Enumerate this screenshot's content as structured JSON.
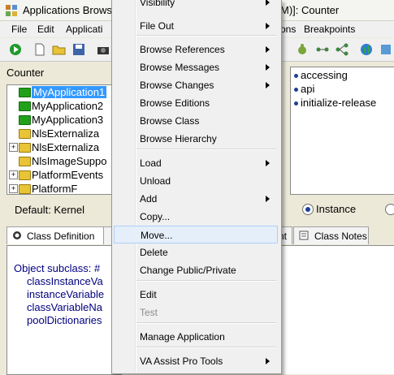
{
  "window": {
    "title_left": "Applications Browse",
    "title_right": "M)]: Counter"
  },
  "menubar": {
    "file": "File",
    "edit": "Edit",
    "applications": "Applicati",
    "options": "ons",
    "breakpoints": "Breakpoints"
  },
  "left": {
    "header": "Counter",
    "tree": [
      {
        "label": "MyApplication1",
        "expander": "",
        "selected": true
      },
      {
        "label": "MyApplication2",
        "expander": "",
        "selected": false
      },
      {
        "label": "MyApplication3",
        "expander": "",
        "selected": false
      },
      {
        "label": "NlsExternaliza",
        "expander": "",
        "selected": false
      },
      {
        "label": "NlsExternaliza",
        "expander": "+",
        "selected": false
      },
      {
        "label": "NlsImageSuppo",
        "expander": "",
        "selected": false
      },
      {
        "label": "PlatformEvents",
        "expander": "+",
        "selected": false
      },
      {
        "label": "PlatformF",
        "expander": "+",
        "selected": false
      }
    ],
    "default_label": "Default: Kernel",
    "tab_class_definition": "Class Definition",
    "code_lines": [
      "Object subclass: #",
      "classInstanceVa",
      "instanceVariable",
      "classVariableNa",
      "poolDictionaries"
    ]
  },
  "right": {
    "protocols": [
      "accessing",
      "api",
      "initialize-release"
    ],
    "instance_label": "Instance",
    "tab_partial": "nt",
    "tab_class_notes": "Class Notes"
  },
  "context_menu": {
    "items": [
      {
        "label": "Visibility",
        "submenu": true,
        "disabled": false,
        "highlighted": false
      },
      {
        "label": "File Out",
        "submenu": true,
        "disabled": false,
        "highlighted": false
      },
      {
        "label": "Browse References",
        "submenu": true,
        "disabled": false,
        "highlighted": false
      },
      {
        "label": "Browse Messages",
        "submenu": true,
        "disabled": false,
        "highlighted": false
      },
      {
        "label": "Browse Changes",
        "submenu": true,
        "disabled": false,
        "highlighted": false
      },
      {
        "label": "Browse Editions",
        "submenu": false,
        "disabled": false,
        "highlighted": false
      },
      {
        "label": "Browse Class",
        "submenu": false,
        "disabled": false,
        "highlighted": false
      },
      {
        "label": "Browse Hierarchy",
        "submenu": false,
        "disabled": false,
        "highlighted": false
      },
      {
        "label": "Load",
        "submenu": true,
        "disabled": false,
        "highlighted": false
      },
      {
        "label": "Unload",
        "submenu": false,
        "disabled": false,
        "highlighted": false
      },
      {
        "label": "Add",
        "submenu": true,
        "disabled": false,
        "highlighted": false
      },
      {
        "label": "Copy...",
        "submenu": false,
        "disabled": false,
        "highlighted": false
      },
      {
        "label": "Move...",
        "submenu": false,
        "disabled": false,
        "highlighted": true
      },
      {
        "label": "Delete",
        "submenu": false,
        "disabled": false,
        "highlighted": false
      },
      {
        "label": "Change Public/Private",
        "submenu": false,
        "disabled": false,
        "highlighted": false
      },
      {
        "label": "Edit",
        "submenu": false,
        "disabled": false,
        "highlighted": false
      },
      {
        "label": "Test",
        "submenu": false,
        "disabled": true,
        "highlighted": false
      },
      {
        "label": "Manage Application",
        "submenu": false,
        "disabled": false,
        "highlighted": false
      },
      {
        "label": "VA Assist Pro Tools",
        "submenu": true,
        "disabled": false,
        "highlighted": false
      }
    ]
  },
  "colors": {
    "selection": "#3399ff",
    "menu_highlight": "#e5effa",
    "folder_green": "#22a01a",
    "folder_yellow": "#e8c436"
  }
}
